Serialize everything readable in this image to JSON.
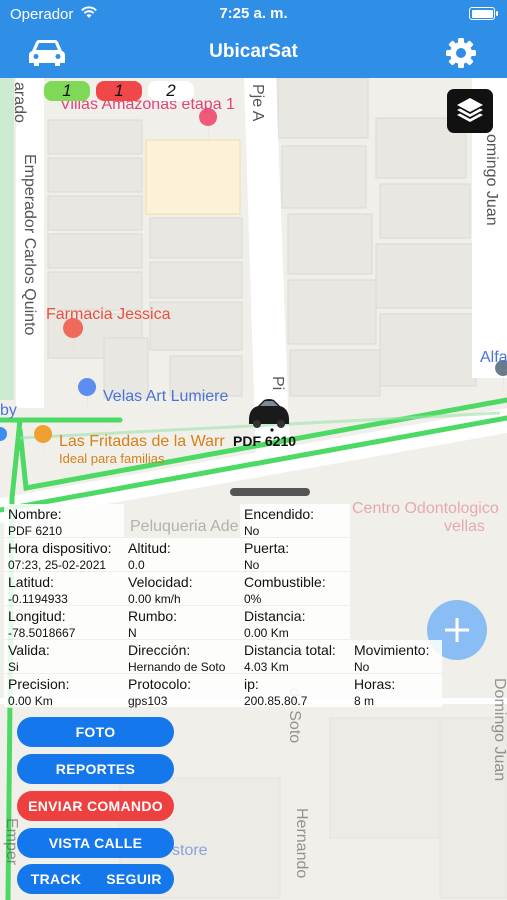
{
  "status_bar": {
    "carrier": "Operador",
    "time": "7:25 a. m."
  },
  "header": {
    "title": "UbicarSat",
    "left_icon": "car-icon",
    "right_icon": "gear-icon"
  },
  "counters": [
    {
      "value": "1",
      "color": "#7ed957"
    },
    {
      "value": "1",
      "color": "#f04848"
    },
    {
      "value": "2",
      "color": "#ffffff"
    }
  ],
  "map": {
    "labels": {
      "street_emperador": "Emperador Carlos Quinto",
      "street_arado": "arado",
      "street_pje_a": "Pje A",
      "street_domingo_juan": "omingo Juan",
      "street_pi": "Pi",
      "street_by": "by",
      "street_alfa": "Alfa",
      "poi_villas": "Villas Amazonas etapa 1",
      "poi_farmacia": "Farmacia Jessica",
      "poi_velas": "Velas Art Lumiere",
      "poi_fritadas": "Las Fritadas de la Warr",
      "poi_fritadas_sub": "Ideal para familias",
      "poi_centro": "Centro Odontologico",
      "poi_centro2": "vellas",
      "poi_peluqueria": "Peluqueria Ade",
      "street_de_soto": "de Soto",
      "street_hernando": "Hernando",
      "street_domingo_juan2": "Domingo Juan",
      "street_emper2": "Emper",
      "poi_store": "store"
    },
    "vehicle_label": "PDF 6210",
    "layers_icon": "layers-icon",
    "fab_icon": "plus-icon"
  },
  "info": {
    "nombre": {
      "label": "Nombre:",
      "value": "PDF 6210"
    },
    "encendido": {
      "label": "Encendido:",
      "value": "No"
    },
    "hora": {
      "label": "Hora dispositivo:",
      "value": "07:23, 25-02-2021"
    },
    "altitud": {
      "label": "Altitud:",
      "value": "0.0"
    },
    "puerta": {
      "label": "Puerta:",
      "value": "No"
    },
    "latitud": {
      "label": "Latitud:",
      "value": "-0.1194933"
    },
    "velocidad": {
      "label": "Velocidad:",
      "value": "0.00 km/h"
    },
    "combustible": {
      "label": "Combustible:",
      "value": "0%"
    },
    "longitud": {
      "label": "Longitud:",
      "value": "-78.5018667"
    },
    "rumbo": {
      "label": "Rumbo:",
      "value": "N"
    },
    "distancia": {
      "label": "Distancia:",
      "value": "0.00 Km"
    },
    "valida": {
      "label": "Valida:",
      "value": "Si"
    },
    "direccion": {
      "label": "Dirección:",
      "value": "Hernando de Soto"
    },
    "distancia_total": {
      "label": "Distancia total:",
      "value": "4.03 Km"
    },
    "movimiento": {
      "label": "Movimiento:",
      "value": "No"
    },
    "precision": {
      "label": "Precision:",
      "value": "0.00 Km"
    },
    "protocolo": {
      "label": "Protocolo:",
      "value": "gps103"
    },
    "ip": {
      "label": "ip:",
      "value": "200.85.80.7"
    },
    "horas": {
      "label": "Horas:",
      "value": "8 m"
    }
  },
  "buttons": {
    "foto": "FOTO",
    "reportes": "REPORTES",
    "enviar_comando": "ENVIAR COMANDO",
    "vista_calle": "VISTA CALLE",
    "track": "TRACK",
    "seguir": "SEGUIR"
  },
  "colors": {
    "primary": "#2f8ee6",
    "button_blue": "#1577ec",
    "button_red": "#ef4040",
    "route_green": "#4cd964"
  }
}
